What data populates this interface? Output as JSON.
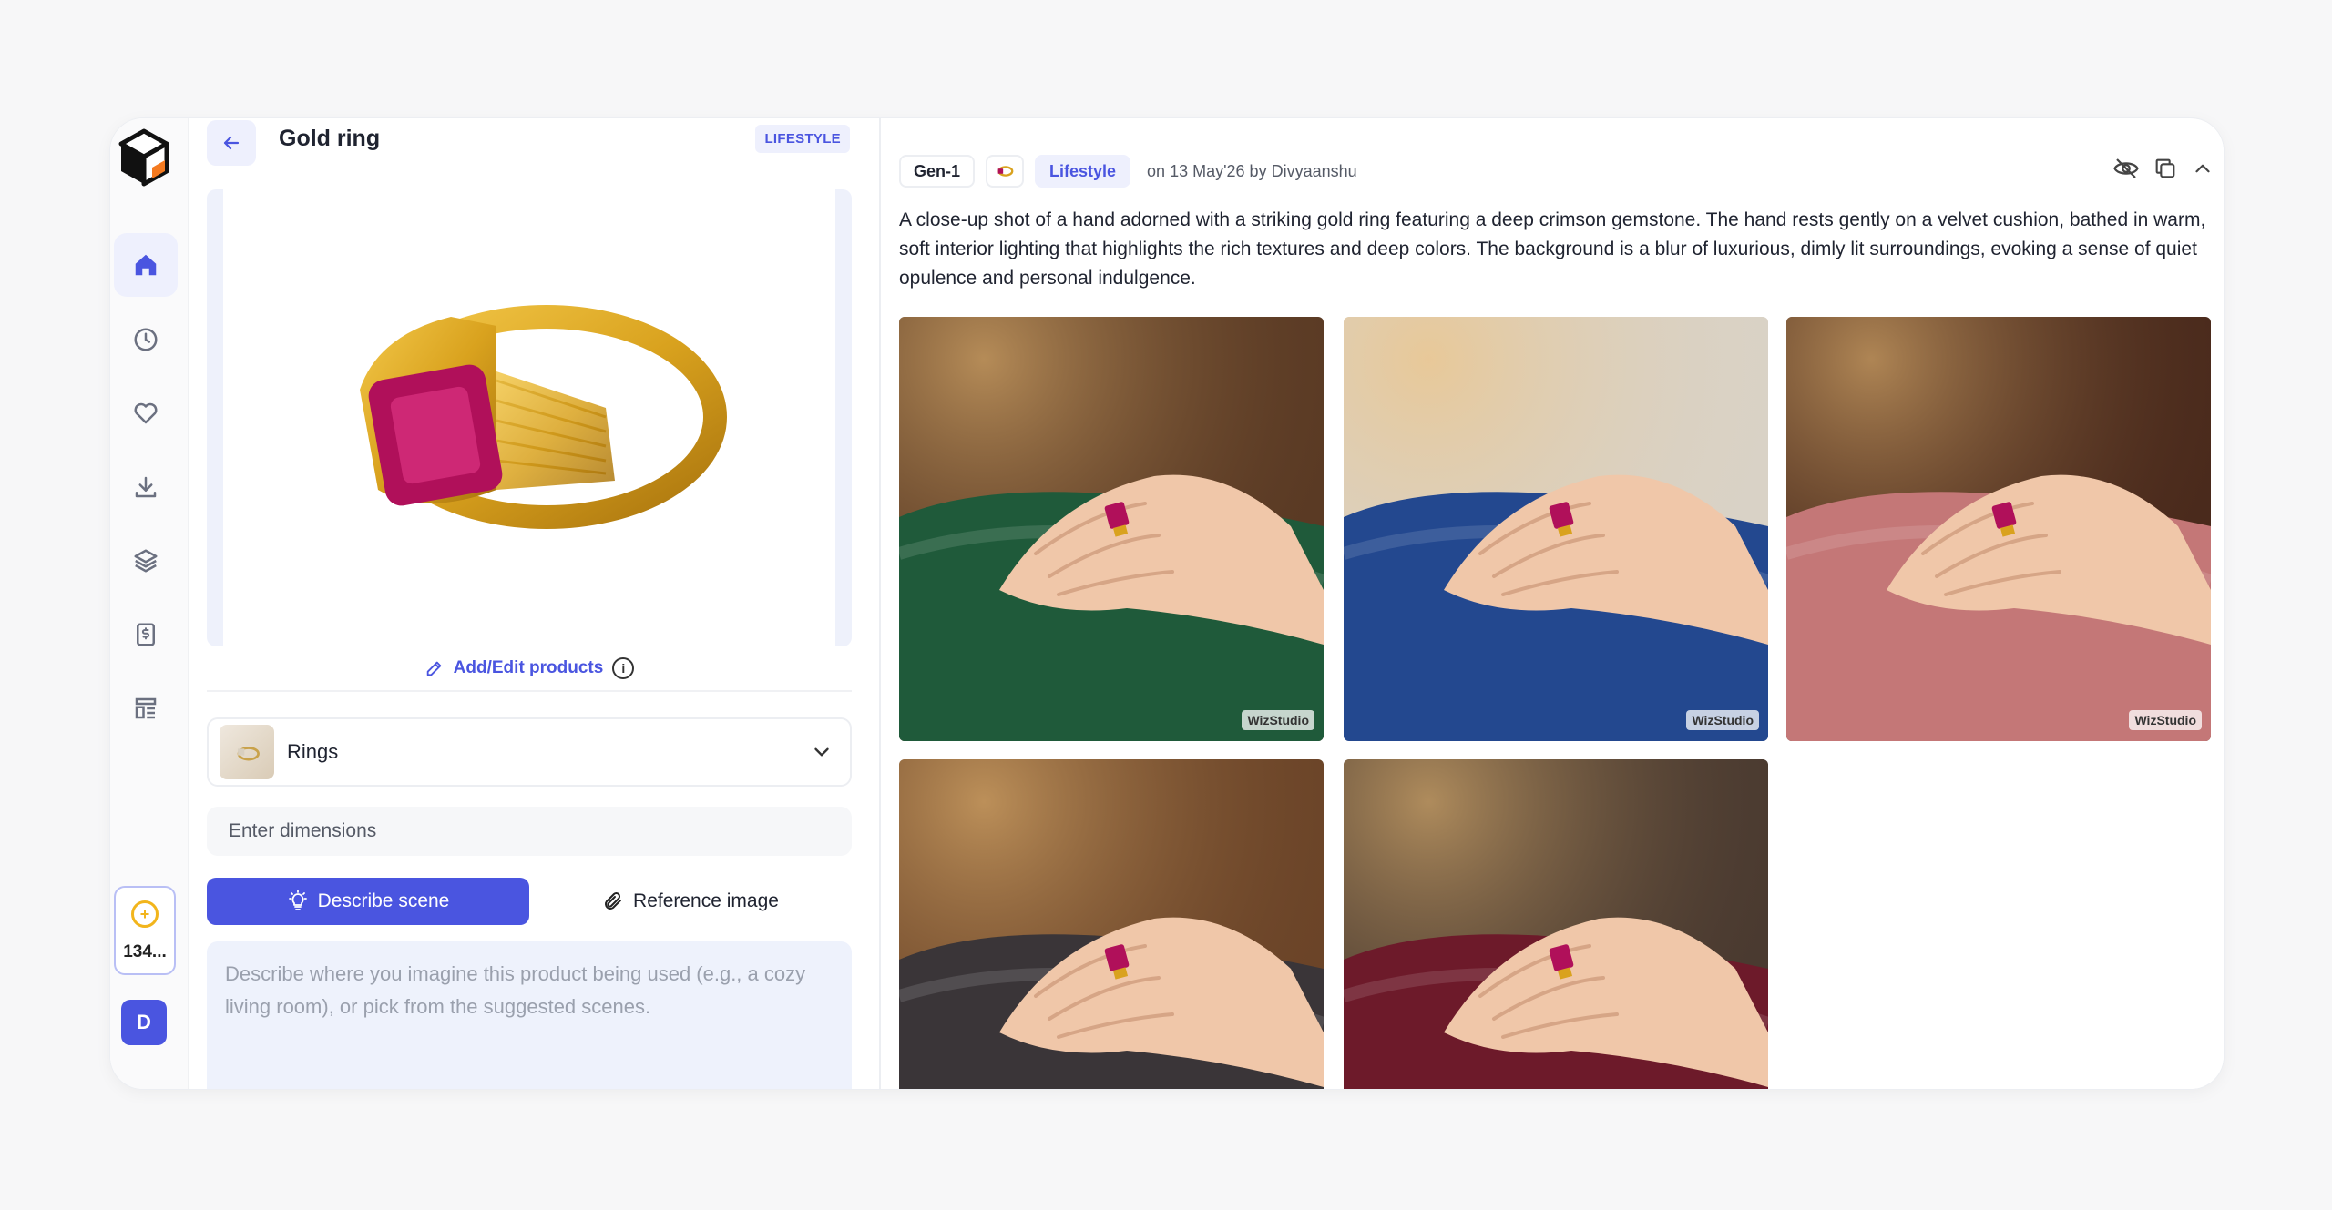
{
  "header": {
    "title": "Gold ring",
    "tag": "LIFESTYLE"
  },
  "product": {
    "add_edit_label": "Add/Edit products",
    "info_icon": "i"
  },
  "category": {
    "selected": "Rings"
  },
  "dimensions": {
    "placeholder": "Enter dimensions"
  },
  "tabs": [
    {
      "label": "Describe scene",
      "active": true
    },
    {
      "label": "Reference image",
      "active": false
    }
  ],
  "scene": {
    "placeholder": "Describe where you imagine this product being used (e.g., a cozy living room), or pick from the suggested scenes."
  },
  "sidebar": {
    "credits": "134...",
    "avatar_initial": "D"
  },
  "result": {
    "model": "Gen-1",
    "style": "Lifestyle",
    "date": "on 13 May'26 by Divyaanshu",
    "description": "A close-up shot of a hand adorned with a striking gold ring featuring a deep crimson gemstone. The hand rests gently on a velvet cushion, bathed in warm, soft interior lighting that highlights the rich textures and deep colors. The background is a blur of luxurious, dimly lit surroundings, evoking a sense of quiet opulence and personal indulgence.",
    "watermark": "WizStudio",
    "images": [
      {
        "cushion": "#1f5a3a",
        "bg": "#5a3a24"
      },
      {
        "cushion": "#23488f",
        "bg": "#d9d2c6"
      },
      {
        "cushion": "#c47777",
        "bg": "#4a2a1c"
      },
      {
        "cushion": "#3a3538",
        "bg": "#6b4428"
      },
      {
        "cushion": "#6d1a2a",
        "bg": "#4a3a30"
      }
    ]
  },
  "colors": {
    "accent": "#4a55e0",
    "gold": "#d9a21e",
    "ruby": "#b0105a"
  }
}
